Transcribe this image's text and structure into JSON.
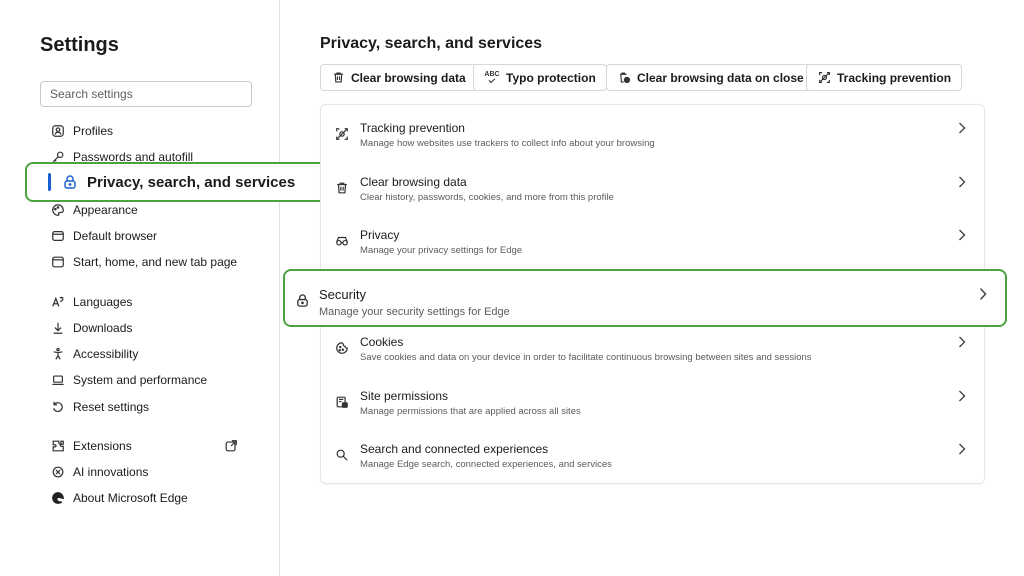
{
  "sidebar": {
    "title": "Settings",
    "search_placeholder": "Search settings",
    "items": [
      {
        "label": "Profiles",
        "icon": "profile-icon"
      },
      {
        "label": "Passwords and autofill",
        "icon": "key-icon"
      },
      {
        "label": "Privacy, search, and services",
        "icon": "lock-icon",
        "selected": true
      },
      {
        "label": "Appearance",
        "icon": "palette-icon"
      },
      {
        "label": "Default browser",
        "icon": "browser-icon"
      },
      {
        "label": "Start, home, and new tab page",
        "icon": "home-tab-icon"
      },
      {
        "label": "Languages",
        "icon": "language-icon"
      },
      {
        "label": "Downloads",
        "icon": "download-icon"
      },
      {
        "label": "Accessibility",
        "icon": "accessibility-icon"
      },
      {
        "label": "System and performance",
        "icon": "laptop-icon"
      },
      {
        "label": "Reset settings",
        "icon": "reset-icon"
      },
      {
        "label": "Extensions",
        "icon": "extensions-icon",
        "external": true
      },
      {
        "label": "AI innovations",
        "icon": "ai-icon"
      },
      {
        "label": "About Microsoft Edge",
        "icon": "edge-logo-icon"
      }
    ]
  },
  "main": {
    "title": "Privacy, search, and services",
    "quick_links": [
      {
        "label": "Clear browsing data",
        "icon": "trash-icon"
      },
      {
        "label": "Typo protection",
        "icon": "abc-check-icon",
        "icon_text": "ABC"
      },
      {
        "label": "Clear browsing data on close",
        "icon": "trash-clock-icon"
      },
      {
        "label": "Tracking prevention",
        "icon": "tracking-icon"
      }
    ],
    "rows": [
      {
        "title": "Tracking prevention",
        "subtitle": "Manage how websites use trackers to collect info about your browsing",
        "icon": "tracking-icon"
      },
      {
        "title": "Clear browsing data",
        "subtitle": "Clear history, passwords, cookies, and more from this profile",
        "icon": "trash-icon"
      },
      {
        "title": "Privacy",
        "subtitle": "Manage your privacy settings for Edge",
        "icon": "glasses-icon"
      },
      {
        "title": "Security",
        "subtitle": "Manage your security settings for Edge",
        "icon": "lock-icon",
        "highlighted": true
      },
      {
        "title": "Cookies",
        "subtitle": "Save cookies and data on your device in order to facilitate continuous browsing between sites and sessions",
        "icon": "cookie-icon"
      },
      {
        "title": "Site permissions",
        "subtitle": "Manage permissions that are applied across all sites",
        "icon": "site-permissions-icon"
      },
      {
        "title": "Search and connected experiences",
        "subtitle": "Manage Edge search, connected experiences, and services",
        "icon": "search-icon"
      }
    ]
  },
  "colors": {
    "highlight_border": "#4aa33f",
    "selected_accent": "#1a5fd1"
  }
}
